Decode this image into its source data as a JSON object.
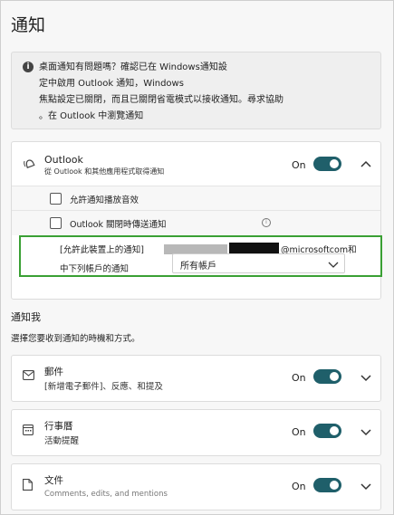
{
  "page": {
    "title": "通知"
  },
  "info": {
    "lines": [
      "桌面通知有問題嗎？確認已在 Windows通知設",
      "定中啟用 Outlook 通知，Windows",
      "焦點設定已關閉，而且已關閉省電模式以接收通知。尋求協助",
      "。在 Outlook 中瀏覽通知"
    ]
  },
  "outlook": {
    "title": "Outlook",
    "subtitle": "從 Outlook 和其他應用程式取得通知",
    "toggle_label": "On",
    "toggle_on": true,
    "options": [
      {
        "label": "允許通知播放音效",
        "checked": false
      },
      {
        "label": "Outlook 關閉時傳送通知",
        "checked": false
      }
    ],
    "account": {
      "line1_prefix": "[允許此裝置上的通知]",
      "line1_suffix": "@microsoftcom和",
      "line2": "中下列帳戶的通知",
      "select_value": "所有帳戶"
    }
  },
  "notify_me": {
    "title": "通知我",
    "subtitle": "選擇您要收到通知的時機和方式。"
  },
  "categories": [
    {
      "title": "郵件",
      "subtitle": "[新增電子郵件]、反應、和提及",
      "toggle_label": "On",
      "icon": "mail-icon"
    },
    {
      "title": "行事曆",
      "subtitle": "活動提醒",
      "toggle_label": "On",
      "icon": "calendar-icon"
    },
    {
      "title": "文件",
      "subtitle": "Comments, edits, and mentions",
      "toggle_label": "On",
      "icon": "document-icon"
    }
  ],
  "colors": {
    "toggle": "#1f5f6a",
    "highlight": "#3aa034"
  }
}
